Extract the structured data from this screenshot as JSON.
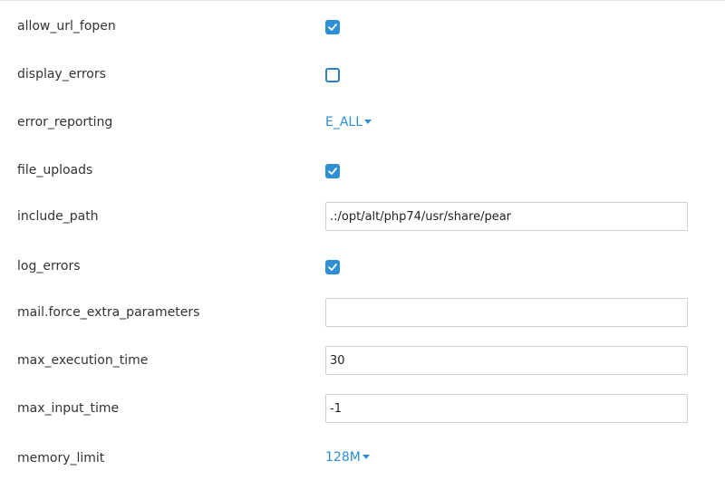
{
  "settings": {
    "allow_url_fopen": {
      "label": "allow_url_fopen",
      "checked": true
    },
    "display_errors": {
      "label": "display_errors",
      "checked": false
    },
    "error_reporting": {
      "label": "error_reporting",
      "value": "E_ALL"
    },
    "file_uploads": {
      "label": "file_uploads",
      "checked": true
    },
    "include_path": {
      "label": "include_path",
      "value": ".:/opt/alt/php74/usr/share/pear"
    },
    "log_errors": {
      "label": "log_errors",
      "checked": true
    },
    "mail_force_extra_parameters": {
      "label": "mail.force_extra_parameters",
      "value": ""
    },
    "max_execution_time": {
      "label": "max_execution_time",
      "value": "30"
    },
    "max_input_time": {
      "label": "max_input_time",
      "value": "-1"
    },
    "memory_limit": {
      "label": "memory_limit",
      "value": "128M"
    }
  },
  "colors": {
    "accent": "#2d8fd5",
    "label_text": "#333333",
    "input_border": "#cfcfcf"
  },
  "icons": {
    "checkbox_checked": "checkmark-icon",
    "dropdown": "caret-down-icon"
  }
}
